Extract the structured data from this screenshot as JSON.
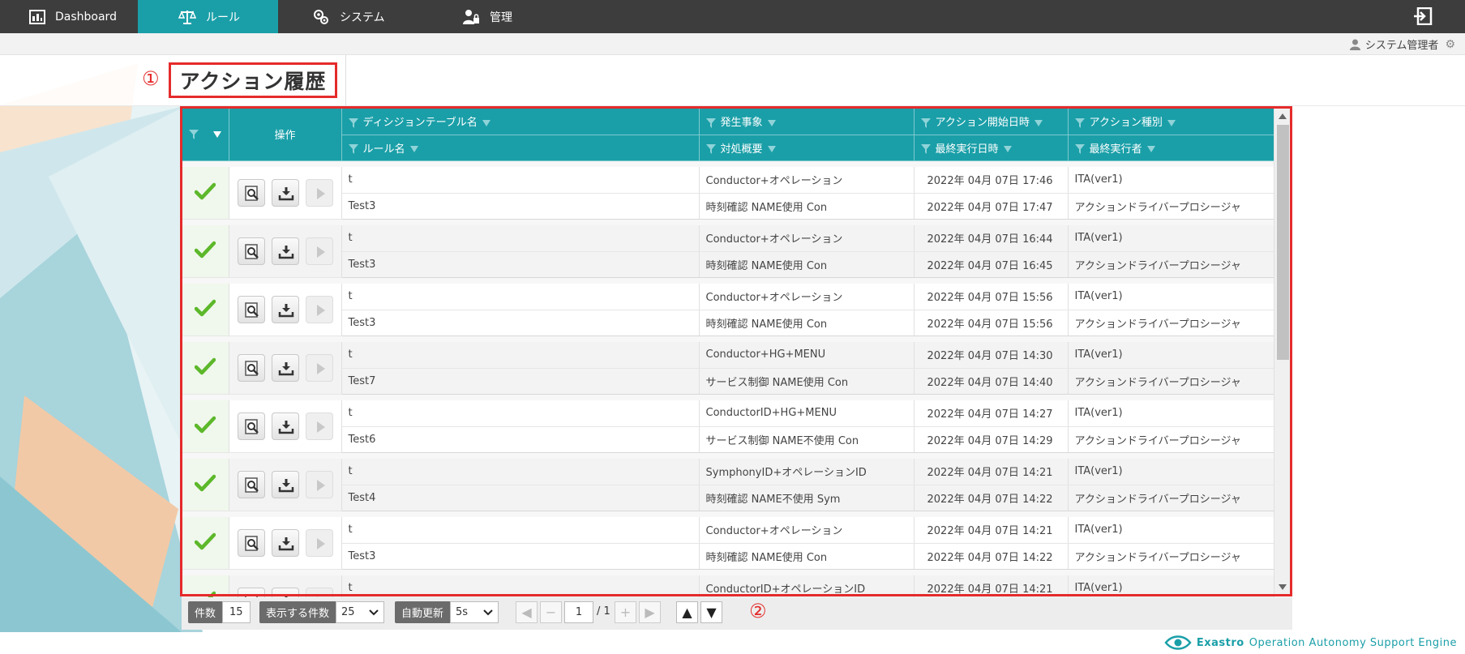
{
  "nav": {
    "items": [
      {
        "label": "Dashboard",
        "icon": "dashboard-icon"
      },
      {
        "label": "ルール",
        "icon": "scales-icon"
      },
      {
        "label": "システム",
        "icon": "gears-icon"
      },
      {
        "label": "管理",
        "icon": "user-lock-icon"
      }
    ],
    "active_index": 1
  },
  "userbar": {
    "user_name": "システム管理者"
  },
  "title": {
    "marker": "①",
    "text": "アクション履歴"
  },
  "table": {
    "headers": {
      "ops": "操作",
      "decision_table": "ディシジョンテーブル名",
      "rule_name": "ルール名",
      "event": "発生事象",
      "action_summary": "対処概要",
      "start_datetime": "アクション開始日時",
      "last_exec_datetime": "最終実行日時",
      "action_type": "アクション種別",
      "last_executor": "最終実行者"
    },
    "rows": [
      {
        "dt": "t",
        "rule": "Test3",
        "event": "Conductor+オペレーション",
        "summary": "時刻確認 NAME使用 Con",
        "start": "2022年 04月 07日 17:46",
        "last": "2022年 04月 07日 17:47",
        "type": "ITA(ver1)",
        "executor": "アクションドライバープロシージャ"
      },
      {
        "dt": "t",
        "rule": "Test3",
        "event": "Conductor+オペレーション",
        "summary": "時刻確認 NAME使用 Con",
        "start": "2022年 04月 07日 16:44",
        "last": "2022年 04月 07日 16:45",
        "type": "ITA(ver1)",
        "executor": "アクションドライバープロシージャ"
      },
      {
        "dt": "t",
        "rule": "Test3",
        "event": "Conductor+オペレーション",
        "summary": "時刻確認 NAME使用 Con",
        "start": "2022年 04月 07日 15:56",
        "last": "2022年 04月 07日 15:56",
        "type": "ITA(ver1)",
        "executor": "アクションドライバープロシージャ"
      },
      {
        "dt": "t",
        "rule": "Test7",
        "event": "Conductor+HG+MENU",
        "summary": "サービス制御 NAME使用 Con",
        "start": "2022年 04月 07日 14:30",
        "last": "2022年 04月 07日 14:40",
        "type": "ITA(ver1)",
        "executor": "アクションドライバープロシージャ"
      },
      {
        "dt": "t",
        "rule": "Test6",
        "event": "ConductorID+HG+MENU",
        "summary": "サービス制御 NAME不使用 Con",
        "start": "2022年 04月 07日 14:27",
        "last": "2022年 04月 07日 14:29",
        "type": "ITA(ver1)",
        "executor": "アクションドライバープロシージャ"
      },
      {
        "dt": "t",
        "rule": "Test4",
        "event": "SymphonyID+オペレーションID",
        "summary": "時刻確認 NAME不使用 Sym",
        "start": "2022年 04月 07日 14:21",
        "last": "2022年 04月 07日 14:22",
        "type": "ITA(ver1)",
        "executor": "アクションドライバープロシージャ"
      },
      {
        "dt": "t",
        "rule": "Test3",
        "event": "Conductor+オペレーション",
        "summary": "時刻確認 NAME使用 Con",
        "start": "2022年 04月 07日 14:21",
        "last": "2022年 04月 07日 14:22",
        "type": "ITA(ver1)",
        "executor": "アクションドライバープロシージャ"
      },
      {
        "dt": "t",
        "rule": "",
        "event": "ConductorID+オペレーションID",
        "summary": "",
        "start": "2022年 04月 07日 14:21",
        "last": "",
        "type": "ITA(ver1)",
        "executor": ""
      }
    ]
  },
  "footer": {
    "count_label": "件数",
    "count_value": "15",
    "perpage_label": "表示する件数",
    "perpage_value": "25",
    "refresh_label": "自動更新",
    "refresh_value": "5s",
    "page_current": "1",
    "page_total": "/ 1",
    "marker": "②"
  },
  "brand": {
    "name": "Exastro",
    "tagline": "Operation Autonomy Support Engine"
  },
  "colors": {
    "accent": "#1a9fa8",
    "nav_bg": "#3d3d3d",
    "annotation_red": "#e52b2b",
    "check_green": "#5cb82a"
  }
}
